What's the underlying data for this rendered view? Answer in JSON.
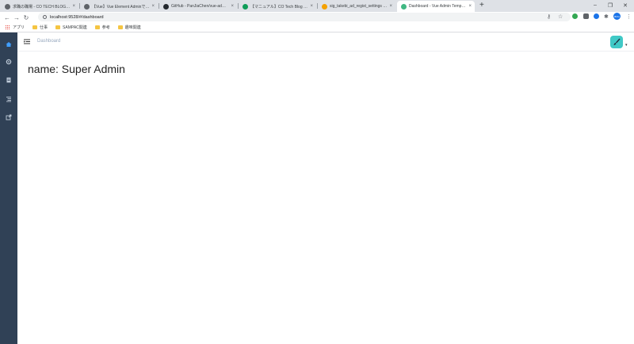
{
  "browser": {
    "tabs": [
      {
        "title": "求職の職場 - CO TECH BLOG - ...",
        "favicon": "spinner-icon",
        "fav_color": "#5f6368"
      },
      {
        "title": "【Vue】Vue Element Adminで簡単...",
        "favicon": "spinner-icon",
        "fav_color": "#5f6368"
      },
      {
        "title": "GitHub - PanJiaChen/vue-admi...",
        "favicon": "github-icon",
        "fav_color": "#24292e"
      },
      {
        "title": "【マニュアル】CO Tech Blog - Goog...",
        "favicon": "sheets-icon",
        "fav_color": "#0f9d58"
      },
      {
        "title": "sig_takebi_ad_regist_settings - L...",
        "favicon": "chart-icon",
        "fav_color": "#f4a100"
      },
      {
        "title": "Dashboard - Vue Admin Templa...",
        "favicon": "vue-icon",
        "fav_color": "#41b883",
        "active": true
      }
    ],
    "new_tab": "+",
    "window_controls": {
      "minimize": "–",
      "maximize": "❐",
      "close": "✕"
    },
    "url": "localhost:9528/#/dashboard",
    "bookmarks": [
      {
        "label": "アプリ",
        "type": "apps"
      },
      {
        "label": "仕事",
        "type": "folder"
      },
      {
        "label": "SAMPAC関連",
        "type": "folder"
      },
      {
        "label": "参考",
        "type": "folder"
      },
      {
        "label": "趣味関連",
        "type": "folder"
      }
    ],
    "profile_initials": "BOU"
  },
  "app": {
    "sidebar_icons": [
      "dashboard-icon",
      "example-icon",
      "form-icon",
      "nested-icon",
      "link-icon"
    ],
    "breadcrumb": "Dashboard",
    "dashboard_text": "name: Super Admin",
    "caret": "▾",
    "colors": {
      "sidebar": "#304156",
      "accent": "#409eff",
      "avatar": "#40c9c6"
    }
  }
}
